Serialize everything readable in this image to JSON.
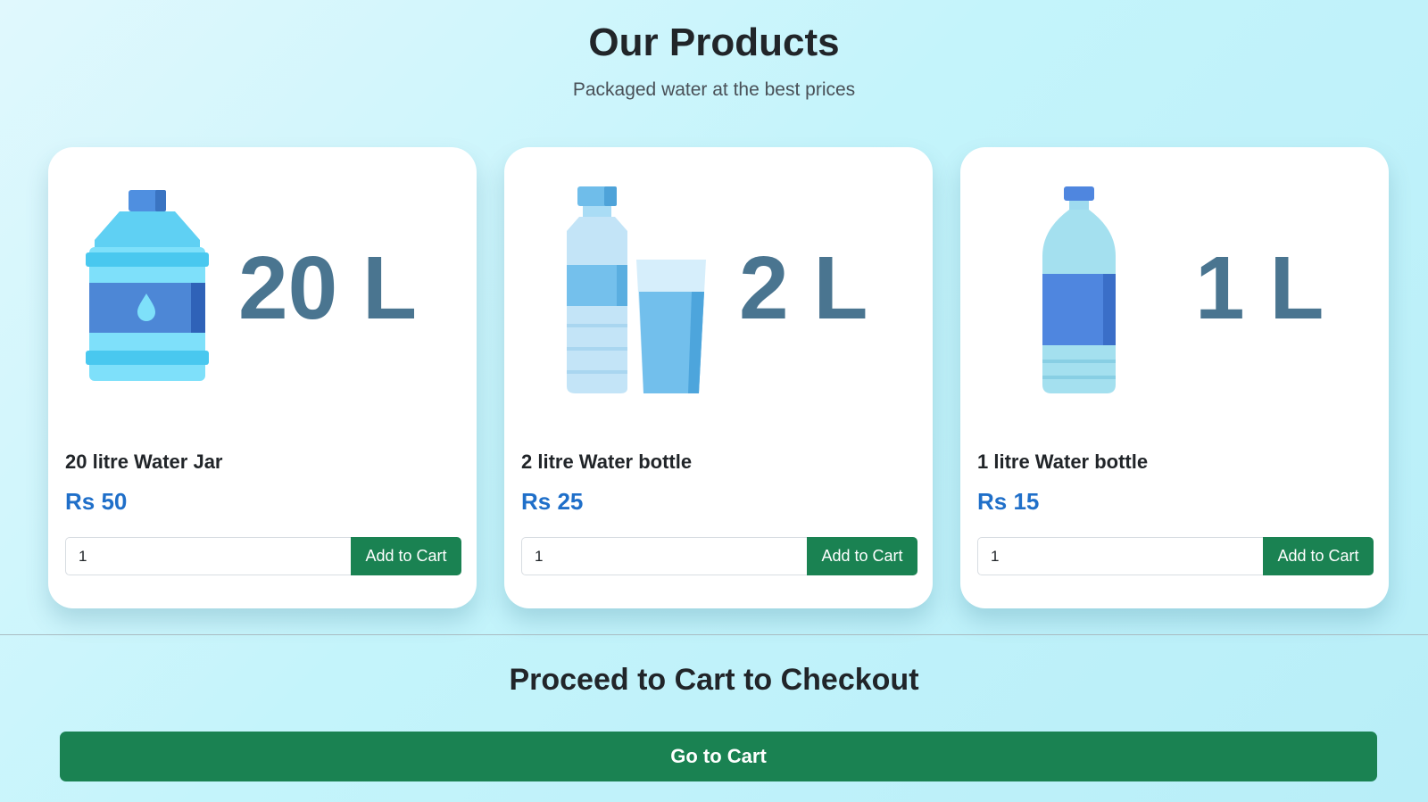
{
  "header": {
    "title": "Our Products",
    "subtitle": "Packaged water at the best prices"
  },
  "products": [
    {
      "name": "20 litre Water Jar",
      "price": "Rs 50",
      "image_label": "20 L",
      "image_icon": "water-jar-icon",
      "quantity": "1",
      "button_label": "Add to Cart"
    },
    {
      "name": "2 litre Water bottle",
      "price": "Rs 25",
      "image_label": "2 L",
      "image_icon": "water-bottle-glass-icon",
      "quantity": "1",
      "button_label": "Add to Cart"
    },
    {
      "name": "1 litre Water bottle",
      "price": "Rs 15",
      "image_label": "1 L",
      "image_icon": "water-bottle-icon",
      "quantity": "1",
      "button_label": "Add to Cart"
    }
  ],
  "checkout": {
    "title": "Proceed to Cart to Checkout",
    "button_label": "Go to Cart"
  },
  "colors": {
    "accent": "#1a8252",
    "price": "#1f6fc9",
    "label": "#4a7590"
  }
}
